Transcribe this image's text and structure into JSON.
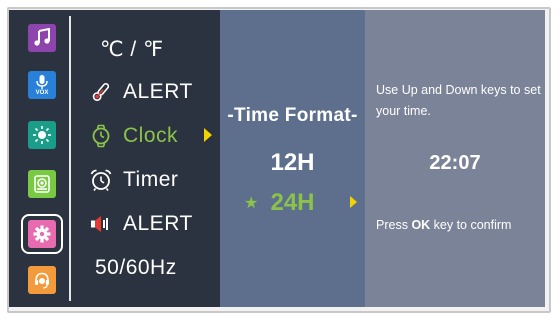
{
  "colors": {
    "strip_bg": "#2b3340",
    "middle_bg": "#5e6f8e",
    "right_bg": "#7b8398",
    "selected": "#8bc34a",
    "arrow": "#f2d400"
  },
  "sidebar": {
    "icons": [
      {
        "name": "music-icon",
        "color": "#8e44ad"
      },
      {
        "name": "vox-mic-icon",
        "color": "#2980d9",
        "label": "VOX"
      },
      {
        "name": "brightness-icon",
        "color": "#1a9e8a"
      },
      {
        "name": "camera-icon",
        "color": "#7ac943"
      },
      {
        "name": "settings-gear-icon",
        "color": "#e86bb0",
        "selected": true
      },
      {
        "name": "support-headset-icon",
        "color": "#f39a3d"
      }
    ]
  },
  "menu": {
    "items": [
      {
        "label": "℃ / ℉",
        "icon": "none"
      },
      {
        "label": "ALERT",
        "icon": "thermometer-icon"
      },
      {
        "label": "Clock",
        "icon": "watch-icon",
        "selected": true
      },
      {
        "label": "Timer",
        "icon": "alarm-clock-icon"
      },
      {
        "label": "ALERT",
        "icon": "speaker-icon"
      },
      {
        "label": "50/60Hz",
        "icon": "none"
      }
    ]
  },
  "time_format": {
    "title": "-Time Format-",
    "options": [
      "12H",
      "24H"
    ],
    "selected": "24H",
    "star": "★"
  },
  "info": {
    "hint": "Use Up and Down keys to set your time.",
    "time": "22:07",
    "confirm_prefix": "Press ",
    "confirm_key": "OK",
    "confirm_suffix": " key to confirm"
  }
}
